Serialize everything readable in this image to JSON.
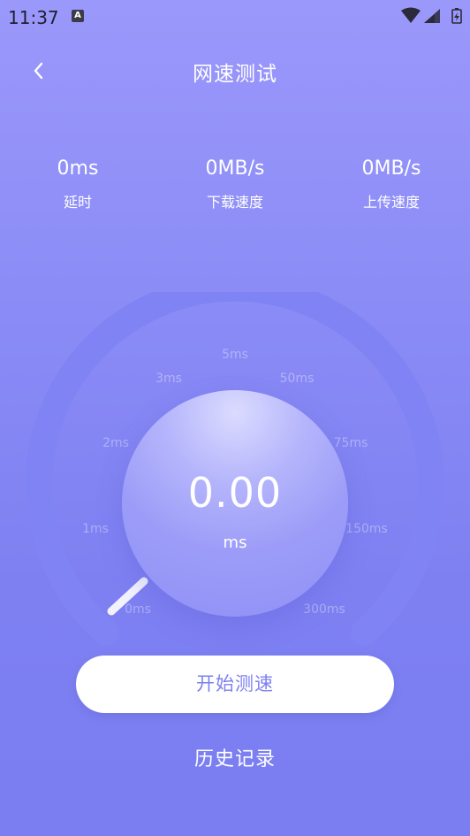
{
  "status_bar": {
    "time": "11:37",
    "notification_icon_letter": "A"
  },
  "header": {
    "title": "网速测试",
    "back_icon": "chevron-left-icon"
  },
  "metrics": [
    {
      "value": "0ms",
      "label": "延时"
    },
    {
      "value": "0MB/s",
      "label": "下载速度"
    },
    {
      "value": "0MB/s",
      "label": "上传速度"
    }
  ],
  "gauge": {
    "ticks": [
      "0ms",
      "1ms",
      "2ms",
      "3ms",
      "5ms",
      "50ms",
      "75ms",
      "150ms",
      "300ms"
    ],
    "reading": "0.00",
    "unit": "ms"
  },
  "actions": {
    "start_label": "开始测速",
    "history_label": "历史记录"
  },
  "colors": {
    "background_top": "#9b98fb",
    "background_bottom": "#7a7ef0",
    "button_text": "#7d80f1",
    "gauge_track": "#8083f4"
  }
}
